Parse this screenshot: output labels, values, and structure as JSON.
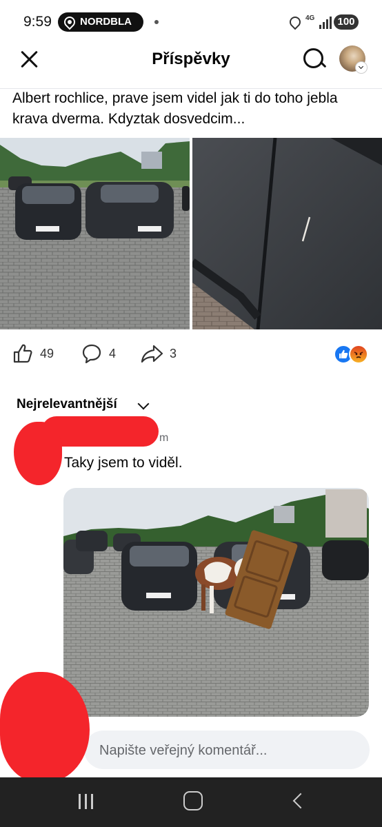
{
  "status_bar": {
    "time": "9:59",
    "location_badge": "NORDBLA",
    "network_label": "4G",
    "battery": "100"
  },
  "header": {
    "title": "Příspěvky",
    "icons": [
      "close-icon",
      "search-icon"
    ]
  },
  "post": {
    "text": "Albert rochlice, prave jsem videl jak ti do toho jebla krava dverma. Kdyztak dosvedcim...",
    "photo_descriptions": [
      "parked-cars-photo",
      "scratched-door-photo"
    ],
    "likes": "49",
    "comments": "4",
    "shares": "3",
    "reactions": [
      "like",
      "angry"
    ]
  },
  "comments": {
    "sort_label": "Nejrelevantnější",
    "items": [
      {
        "time_fragment": "m",
        "text": "Taky jsem to viděl."
      }
    ]
  },
  "composer": {
    "placeholder": "Napište veřejný komentář..."
  },
  "colors": {
    "redaction": "#f4252b",
    "like_blue": "#1877f2",
    "input_bg": "#f0f2f5",
    "nav_bg": "#222222"
  }
}
